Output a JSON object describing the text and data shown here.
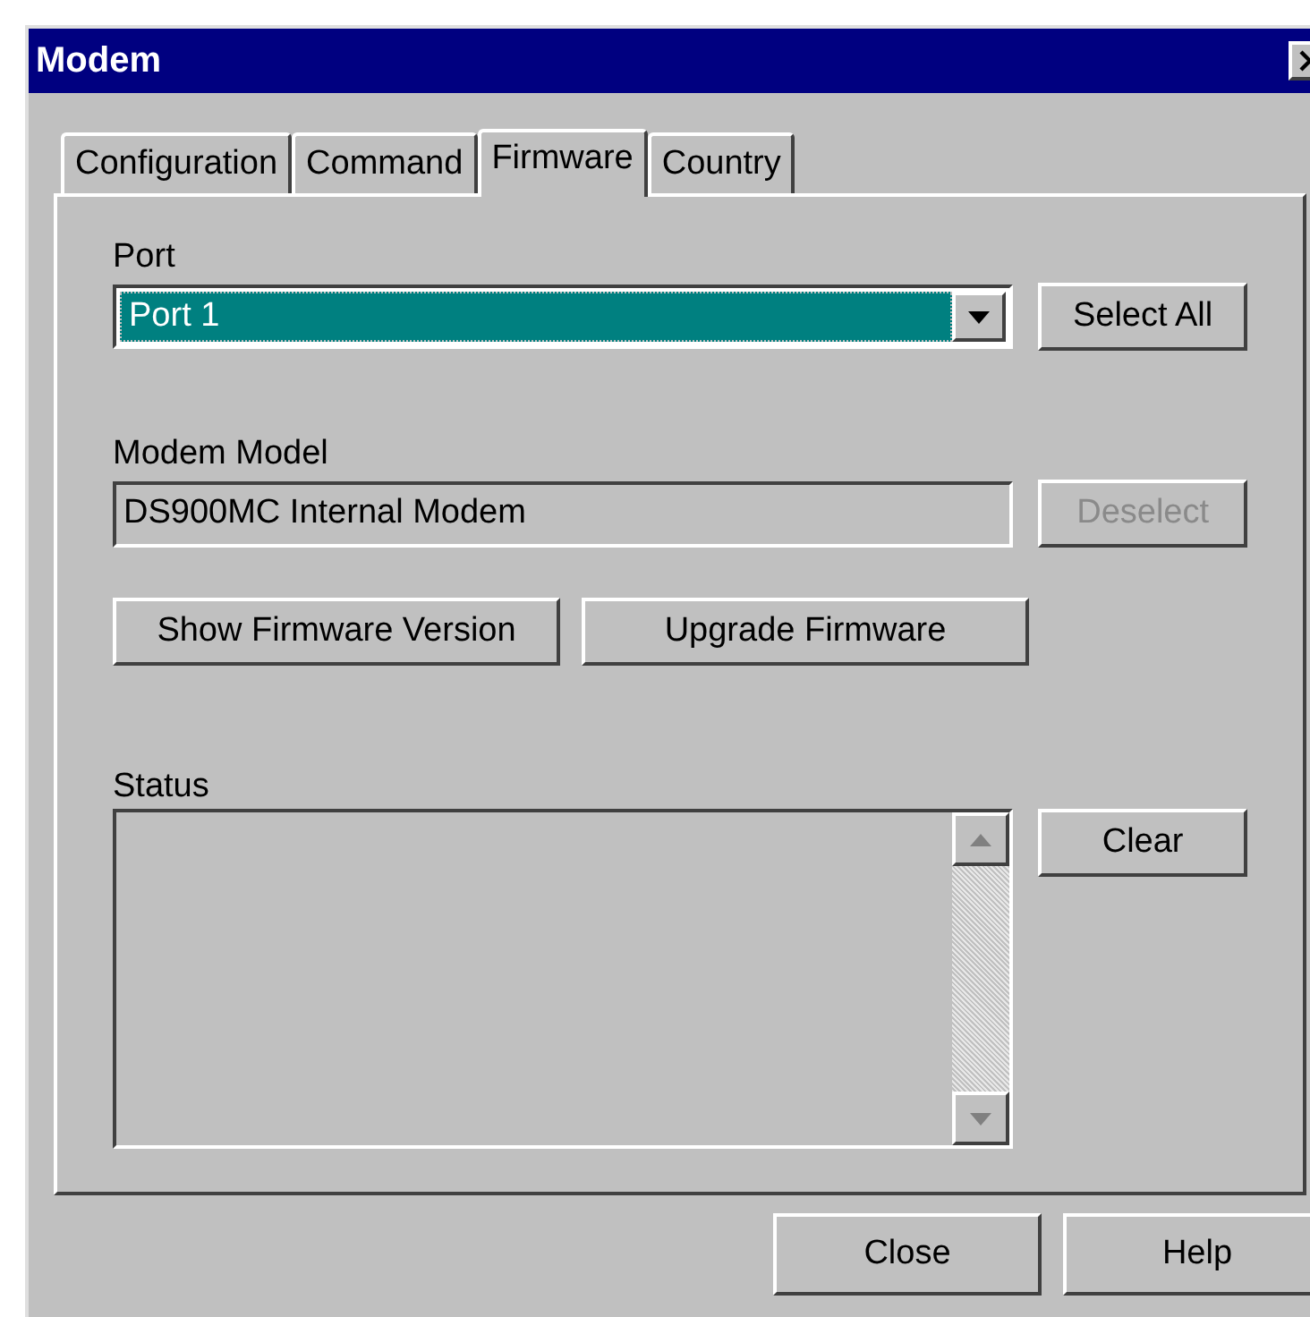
{
  "window": {
    "title": "Modem"
  },
  "tabs": [
    {
      "label": "Configuration",
      "selected": false
    },
    {
      "label": "Command",
      "selected": false
    },
    {
      "label": "Firmware",
      "selected": true
    },
    {
      "label": "Country",
      "selected": false
    }
  ],
  "port": {
    "label": "Port",
    "value": "Port 1",
    "button": {
      "label": "Select All",
      "disabled": false
    }
  },
  "modem_model": {
    "label": "Modem Model",
    "value": "DS900MC Internal Modem",
    "button": {
      "label": "Deselect",
      "disabled": true
    }
  },
  "actions": [
    {
      "label": "Show Firmware Version",
      "disabled": false
    },
    {
      "label": "Upgrade Firmware",
      "disabled": false
    }
  ],
  "status": {
    "label": "Status",
    "button": {
      "label": "Clear",
      "disabled": false
    }
  },
  "footer_buttons": [
    {
      "label": "Close",
      "disabled": false
    },
    {
      "label": "Help",
      "disabled": false
    }
  ]
}
